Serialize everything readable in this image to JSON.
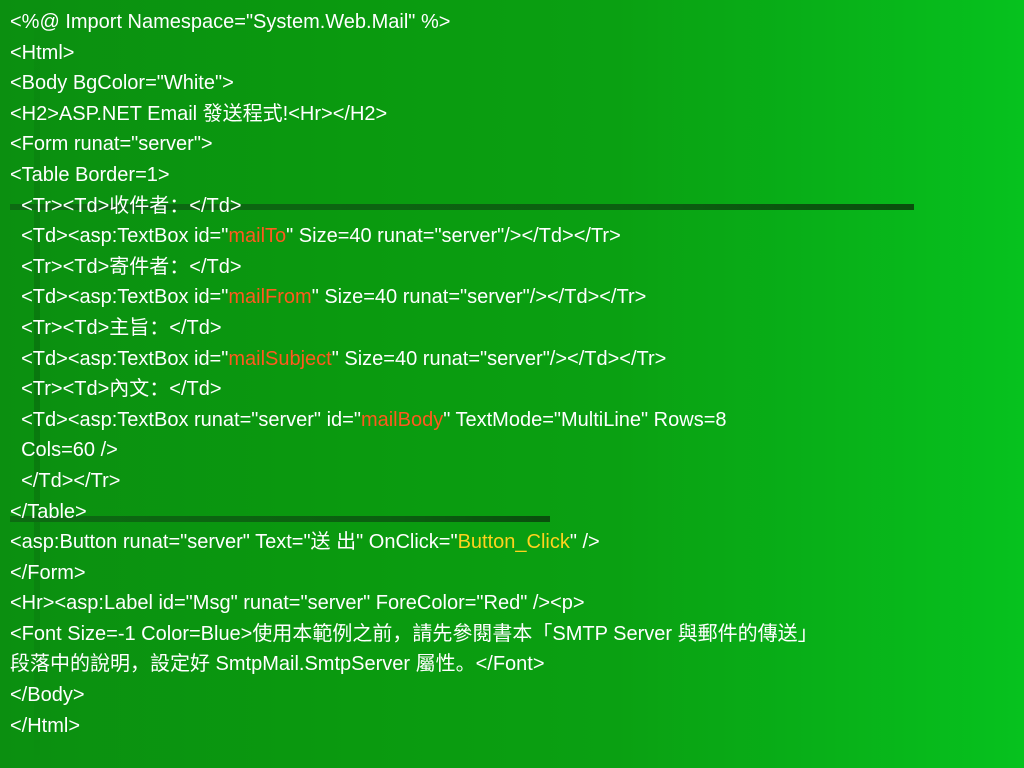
{
  "slide": {
    "lines": [
      [
        {
          "text": "<%@ Import Namespace=\"System.Web.Mail\" %>"
        }
      ],
      [
        {
          "text": "<Html>"
        }
      ],
      [
        {
          "text": "<Body BgColor=\"White\">"
        }
      ],
      [
        {
          "text": "<H2>ASP.NET Email 發送程式!<Hr></H2>"
        }
      ],
      [
        {
          "text": "<Form runat=\"server\">"
        }
      ],
      [
        {
          "text": "<Table Border=1>"
        }
      ],
      [
        {
          "text": "  <Tr><Td>收件者：</Td>"
        }
      ],
      [
        {
          "text": "  <Td><asp:TextBox id=\""
        },
        {
          "text": "mailTo",
          "hl": "orange"
        },
        {
          "text": "\" Size=40 runat=\"server\"/></Td></Tr>"
        }
      ],
      [
        {
          "text": "  <Tr><Td>寄件者：</Td>"
        }
      ],
      [
        {
          "text": "  <Td><asp:TextBox id=\""
        },
        {
          "text": "mailFrom",
          "hl": "orange"
        },
        {
          "text": "\" Size=40 runat=\"server\"/></Td></Tr>"
        }
      ],
      [
        {
          "text": "  <Tr><Td>主旨：</Td>"
        }
      ],
      [
        {
          "text": "  <Td><asp:TextBox id=\""
        },
        {
          "text": "mailSubject",
          "hl": "orange"
        },
        {
          "text": "\" Size=40 runat=\"server\"/></Td></Tr>"
        }
      ],
      [
        {
          "text": "  <Tr><Td>內文：</Td>"
        }
      ],
      [
        {
          "text": "  <Td><asp:TextBox runat=\"server\" id=\""
        },
        {
          "text": "mailBody",
          "hl": "orange"
        },
        {
          "text": "\" TextMode=\"MultiLine\" Rows=8"
        }
      ],
      [
        {
          "text": "  Cols=60 />"
        }
      ],
      [
        {
          "text": "  </Td></Tr>"
        }
      ],
      [
        {
          "text": "</Table>"
        }
      ],
      [
        {
          "text": "<asp:Button runat=\"server\" Text=\"送 出\" OnClick=\""
        },
        {
          "text": "Button_Click",
          "hl": "yellow"
        },
        {
          "text": "\" />"
        }
      ],
      [
        {
          "text": "</Form>"
        }
      ],
      [
        {
          "text": "<Hr><asp:Label id=\"Msg\" runat=\"server\" ForeColor=\"Red\" /><p>"
        }
      ],
      [
        {
          "text": "<Font Size=-1 Color=Blue>使用本範例之前，請先參閱書本「SMTP Server 與郵件的傳送」"
        }
      ],
      [
        {
          "text": "段落中的說明，設定好 SmtpMail.SmtpServer 屬性。</Font>"
        }
      ],
      [
        {
          "text": "</Body>"
        }
      ],
      [
        {
          "text": "</Html>"
        }
      ]
    ]
  },
  "colors": {
    "text": "#ffffff",
    "highlight_orange": "#ff5a1e",
    "highlight_yellow": "#ffd21e"
  }
}
